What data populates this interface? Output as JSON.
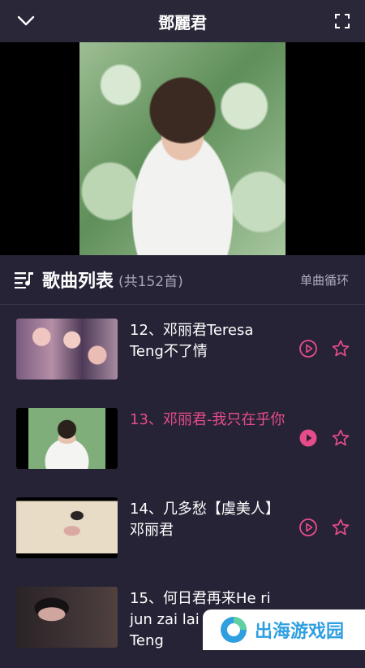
{
  "header": {
    "title": "鄧麗君",
    "back_icon": "chevron-down-icon",
    "fullscreen_icon": "fullscreen-icon"
  },
  "playlist": {
    "title": "歌曲列表",
    "count": "(共152首)",
    "mode": "单曲循环"
  },
  "songs": [
    {
      "title": "12、邓丽君Teresa Teng不了情",
      "active": false
    },
    {
      "title": "13、邓丽君-我只在乎你",
      "active": true
    },
    {
      "title": "14、几多愁【虞美人】邓丽君",
      "active": false
    },
    {
      "title": "15、何日君再来He ri jun zai lai Teresa Teng",
      "active": false
    }
  ],
  "watermark": {
    "text": "出海游戏园"
  },
  "colors": {
    "accent": "#e74c8a",
    "background": "#262336",
    "icon": "#e74c8a"
  }
}
